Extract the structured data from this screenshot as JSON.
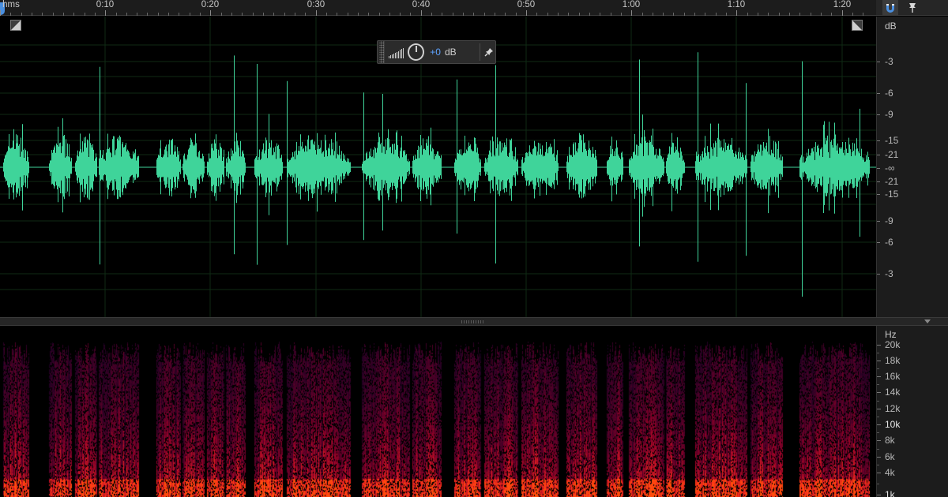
{
  "ruler": {
    "format_label": "hms",
    "time_labels": [
      "0:10",
      "0:20",
      "0:30",
      "0:40",
      "0:50",
      "1:00",
      "1:10",
      "1:20"
    ]
  },
  "toolbar_right": {
    "buttons": [
      {
        "name": "snap-magnet-icon",
        "active": true
      },
      {
        "name": "marker-pin-icon",
        "active": false
      }
    ]
  },
  "hud": {
    "gain_value": "+0",
    "gain_unit": "dB"
  },
  "db_scale": {
    "unit": "dB",
    "labels": [
      "-3",
      "-6",
      "-9",
      "-15",
      "-21",
      "-∞",
      "-21",
      "-15",
      "-9",
      "-6",
      "-3"
    ]
  },
  "hz_scale": {
    "unit": "Hz",
    "labels": [
      "20k",
      "18k",
      "16k",
      "14k",
      "12k",
      "10k",
      "8k",
      "6k",
      "4k",
      "1k"
    ],
    "highlighted": [
      "10k",
      "1k"
    ]
  },
  "colors": {
    "waveform": "#3fd49a",
    "playhead": "#4a8fe0",
    "hud_value": "#5ea3ff",
    "spectrogram_low": "#2a0a4a",
    "spectrogram_high": "#ff4a1a"
  }
}
